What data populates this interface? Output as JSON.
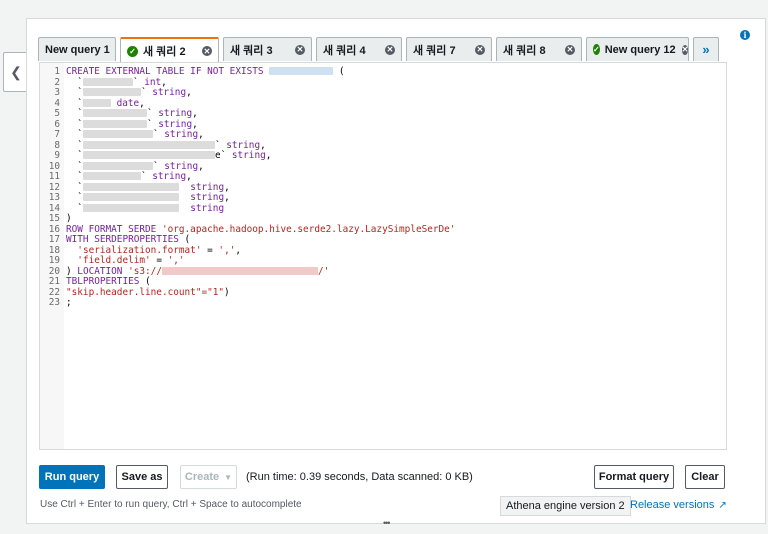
{
  "tabs": [
    {
      "label": "New query 1",
      "status": "none",
      "closable": false,
      "active": false
    },
    {
      "label": "새 쿼리 2",
      "status": "success",
      "closable": true,
      "active": true
    },
    {
      "label": "새 쿼리 3",
      "status": "none",
      "closable": true,
      "active": false
    },
    {
      "label": "새 쿼리 4",
      "status": "none",
      "closable": true,
      "active": false
    },
    {
      "label": "새 쿼리 7",
      "status": "none",
      "closable": true,
      "active": false
    },
    {
      "label": "새 쿼리 8",
      "status": "none",
      "closable": true,
      "active": false
    },
    {
      "label": "New query 12",
      "status": "success",
      "closable": true,
      "active": false
    }
  ],
  "more_tabs_icon": "double-chevron-right-icon",
  "collapse_icon": "chevron-left-icon",
  "info_icon": "info-icon",
  "editor": {
    "lines": [
      [
        {
          "t": "kw",
          "v": "CREATE EXTERNAL TABLE IF NOT EXISTS "
        },
        {
          "t": "blur",
          "w": 64,
          "c": "blue"
        },
        {
          "t": "txt",
          "v": " ("
        }
      ],
      [
        {
          "t": "txt",
          "v": "  `"
        },
        {
          "t": "blur",
          "w": 50
        },
        {
          "t": "txt",
          "v": "` "
        },
        {
          "t": "kw",
          "v": "int"
        },
        {
          "t": "txt",
          "v": ","
        }
      ],
      [
        {
          "t": "txt",
          "v": "  `"
        },
        {
          "t": "blur",
          "w": 58
        },
        {
          "t": "txt",
          "v": "` "
        },
        {
          "t": "kw",
          "v": "string"
        },
        {
          "t": "txt",
          "v": ","
        }
      ],
      [
        {
          "t": "txt",
          "v": "  `"
        },
        {
          "t": "blur",
          "w": 28
        },
        {
          "t": "txt",
          "v": " "
        },
        {
          "t": "kw",
          "v": "date"
        },
        {
          "t": "txt",
          "v": ","
        }
      ],
      [
        {
          "t": "txt",
          "v": "  `"
        },
        {
          "t": "blur",
          "w": 64
        },
        {
          "t": "txt",
          "v": "` "
        },
        {
          "t": "kw",
          "v": "string"
        },
        {
          "t": "txt",
          "v": ","
        }
      ],
      [
        {
          "t": "txt",
          "v": "  `"
        },
        {
          "t": "blur",
          "w": 64
        },
        {
          "t": "txt",
          "v": "` "
        },
        {
          "t": "kw",
          "v": "string"
        },
        {
          "t": "txt",
          "v": ","
        }
      ],
      [
        {
          "t": "txt",
          "v": "  `"
        },
        {
          "t": "blur",
          "w": 70
        },
        {
          "t": "txt",
          "v": "` "
        },
        {
          "t": "kw",
          "v": "string"
        },
        {
          "t": "txt",
          "v": ","
        }
      ],
      [
        {
          "t": "txt",
          "v": "  `"
        },
        {
          "t": "blur",
          "w": 132
        },
        {
          "t": "txt",
          "v": "` "
        },
        {
          "t": "kw",
          "v": "string"
        },
        {
          "t": "txt",
          "v": ","
        }
      ],
      [
        {
          "t": "txt",
          "v": "  `"
        },
        {
          "t": "blur",
          "w": 132
        },
        {
          "t": "txt",
          "v": "e` "
        },
        {
          "t": "kw",
          "v": "string"
        },
        {
          "t": "txt",
          "v": ","
        }
      ],
      [
        {
          "t": "txt",
          "v": "  `"
        },
        {
          "t": "blur",
          "w": 70
        },
        {
          "t": "txt",
          "v": "` "
        },
        {
          "t": "kw",
          "v": "string"
        },
        {
          "t": "txt",
          "v": ","
        }
      ],
      [
        {
          "t": "txt",
          "v": "  `"
        },
        {
          "t": "blur",
          "w": 58
        },
        {
          "t": "txt",
          "v": "` "
        },
        {
          "t": "kw",
          "v": "string"
        },
        {
          "t": "txt",
          "v": ","
        }
      ],
      [
        {
          "t": "txt",
          "v": "  `"
        },
        {
          "t": "blur",
          "w": 96
        },
        {
          "t": "txt",
          "v": "  "
        },
        {
          "t": "kw",
          "v": "string"
        },
        {
          "t": "txt",
          "v": ","
        }
      ],
      [
        {
          "t": "txt",
          "v": "  `"
        },
        {
          "t": "blur",
          "w": 96
        },
        {
          "t": "txt",
          "v": "  "
        },
        {
          "t": "kw",
          "v": "string"
        },
        {
          "t": "txt",
          "v": ","
        }
      ],
      [
        {
          "t": "txt",
          "v": "  `"
        },
        {
          "t": "blur",
          "w": 96
        },
        {
          "t": "txt",
          "v": "  "
        },
        {
          "t": "kw",
          "v": "string"
        }
      ],
      [
        {
          "t": "txt",
          "v": ")"
        }
      ],
      [
        {
          "t": "kw",
          "v": "ROW FORMAT SERDE "
        },
        {
          "t": "str",
          "v": "'org.apache.hadoop.hive.serde2.lazy.LazySimpleSerDe'"
        }
      ],
      [
        {
          "t": "kw",
          "v": "WITH SERDEPROPERTIES "
        },
        {
          "t": "txt",
          "v": "("
        }
      ],
      [
        {
          "t": "txt",
          "v": "  "
        },
        {
          "t": "str",
          "v": "'serialization.format'"
        },
        {
          "t": "txt",
          "v": " = "
        },
        {
          "t": "str",
          "v": "','"
        },
        {
          "t": "txt",
          "v": ","
        }
      ],
      [
        {
          "t": "txt",
          "v": "  "
        },
        {
          "t": "str",
          "v": "'field.delim'"
        },
        {
          "t": "txt",
          "v": " = "
        },
        {
          "t": "str",
          "v": "','"
        }
      ],
      [
        {
          "t": "txt",
          "v": ") "
        },
        {
          "t": "kw",
          "v": "LOCATION "
        },
        {
          "t": "str",
          "v": "'s3://"
        },
        {
          "t": "blur",
          "w": 156,
          "c": "red"
        },
        {
          "t": "str",
          "v": "/'"
        }
      ],
      [
        {
          "t": "kw",
          "v": "TBLPROPERTIES "
        },
        {
          "t": "txt",
          "v": "("
        }
      ],
      [
        {
          "t": "str",
          "v": "\"skip.header.line.count\"=\"1\""
        },
        {
          "t": "txt",
          "v": ")"
        }
      ],
      [
        {
          "t": "txt",
          "v": ";"
        }
      ]
    ]
  },
  "toolbar": {
    "run_label": "Run query",
    "save_as_label": "Save as",
    "create_label": "Create",
    "create_icon": "chevron-down-icon",
    "run_info": "(Run time: 0.39 seconds, Data scanned: 0 KB)",
    "format_label": "Format query",
    "clear_label": "Clear"
  },
  "footer": {
    "hint": "Use Ctrl + Enter to run query, Ctrl + Space to autocomplete",
    "engine": "Athena engine version 2",
    "release_label": "Release versions",
    "release_icon": "external-link-icon"
  },
  "colors": {
    "primary": "#0073bb",
    "active_tab_accent": "#ec7211",
    "success": "#1d8102",
    "keyword": "#7a1fa2",
    "string": "#b3261e"
  }
}
